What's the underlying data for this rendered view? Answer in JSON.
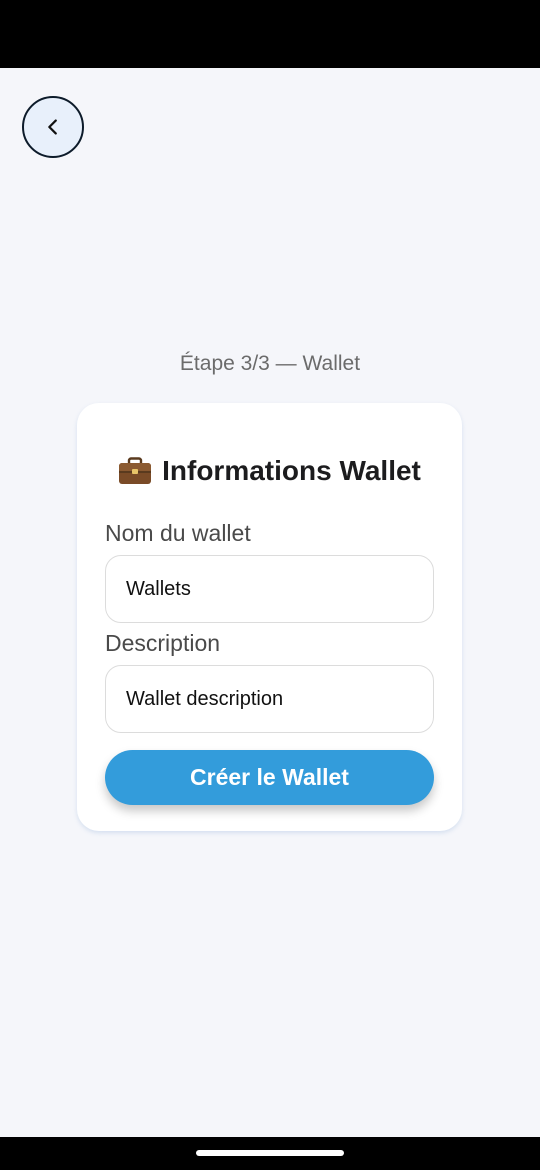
{
  "step": {
    "label": "Étape 3/3 — Wallet"
  },
  "card": {
    "icon": "briefcase-icon",
    "title": "Informations Wallet",
    "name_field": {
      "label": "Nom du wallet",
      "value": "Wallets"
    },
    "description_field": {
      "label": "Description",
      "value": "Wallet description"
    },
    "submit_label": "Créer le Wallet"
  },
  "nav": {
    "back_icon": "chevron-left-icon"
  },
  "colors": {
    "background": "#f5f6fa",
    "accent": "#339cdb",
    "back_button_fill": "#e8f0fb",
    "back_button_border": "#0d1b2a"
  }
}
